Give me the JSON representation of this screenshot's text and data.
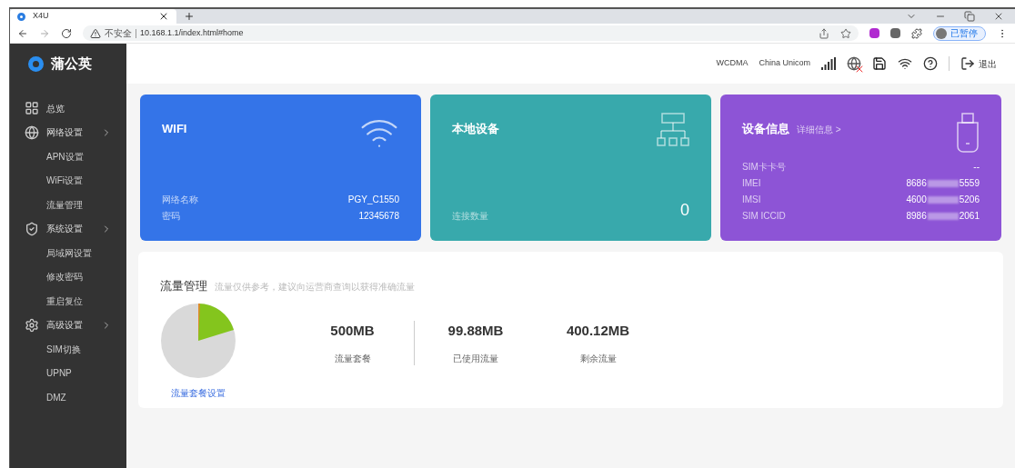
{
  "browser": {
    "tab_title": "X4U",
    "security": "不安全",
    "url": "10.168.1.1/index.html#home",
    "profile": "已暂停"
  },
  "app": {
    "brand": "蒲公英"
  },
  "header": {
    "network_type": "WCDMA",
    "carrier": "China Unicom",
    "logout": "退出"
  },
  "sidebar": {
    "items": [
      {
        "label": "总览"
      },
      {
        "label": "网络设置",
        "children": [
          {
            "label": "APN设置"
          },
          {
            "label": "WiFi设置"
          },
          {
            "label": "流量管理"
          }
        ]
      },
      {
        "label": "系统设置",
        "children": [
          {
            "label": "局域网设置"
          },
          {
            "label": "修改密码"
          },
          {
            "label": "重启复位"
          }
        ]
      },
      {
        "label": "高级设置",
        "children": [
          {
            "label": "SIM切换"
          },
          {
            "label": "UPNP"
          },
          {
            "label": "DMZ"
          }
        ]
      }
    ]
  },
  "cards": [
    {
      "kind": "wifi",
      "title": "WIFI",
      "color": "#3474e8",
      "rows": [
        {
          "label": "网络名称",
          "value": "PGY_C1550"
        },
        {
          "label": "密码",
          "value": "12345678"
        }
      ]
    },
    {
      "kind": "devices",
      "title": "本地设备",
      "color": "#38a9ac",
      "count_label": "连接数量",
      "count": "0"
    },
    {
      "kind": "info",
      "title": "设备信息",
      "color": "#8d54d6",
      "link": "详细信息 >",
      "rows": [
        {
          "label": "SIM卡卡号",
          "value": "--"
        },
        {
          "label": "IMEI",
          "start": "8686",
          "end": "5559"
        },
        {
          "label": "IMSI",
          "start": "4600",
          "end": "5206"
        },
        {
          "label": "SIM ICCID",
          "start": "8986",
          "end": "2061"
        }
      ]
    }
  ],
  "traffic": {
    "title": "流量管理",
    "note": "流量仅供参考，建议向运营商查询以获得准确流量",
    "settings_link": "流量套餐设置",
    "stats": [
      {
        "value": "500MB",
        "label": "流量套餐"
      },
      {
        "value": "99.88MB",
        "label": "已使用流量"
      },
      {
        "value": "400.12MB",
        "label": "剩余流量"
      }
    ]
  }
}
